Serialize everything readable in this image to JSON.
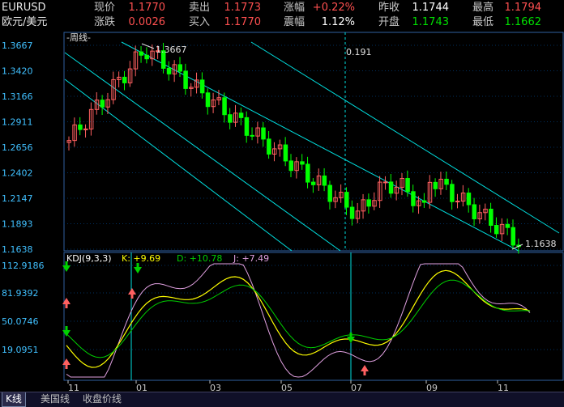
{
  "quote": {
    "symbol": "EURUSD",
    "name": "欧元/美元",
    "row1": [
      {
        "label": "现价",
        "value": "1.1770",
        "color": "red"
      },
      {
        "label": "卖出",
        "value": "1.1773",
        "color": "red"
      },
      {
        "label": "涨幅",
        "value": "+0.22%",
        "color": "red"
      },
      {
        "label": "昨收",
        "value": "1.1744",
        "color": "wht"
      },
      {
        "label": "最高",
        "value": "1.1794",
        "color": "red"
      }
    ],
    "row2": [
      {
        "label": "涨跌",
        "value": "0.0026",
        "color": "red"
      },
      {
        "label": "买入",
        "value": "1.1770",
        "color": "red"
      },
      {
        "label": "震幅",
        "value": "1.12%",
        "color": "wht"
      },
      {
        "label": "开盘",
        "value": "1.1743",
        "color": "grn"
      },
      {
        "label": "最低",
        "value": "1.1662",
        "color": "grn"
      }
    ]
  },
  "main_chart": {
    "period_label": "-周线-",
    "y_ticks": [
      "1.3667",
      "1.3420",
      "1.3166",
      "1.2911",
      "1.2656",
      "1.2402",
      "1.2147",
      "1.1893",
      "1.1638"
    ],
    "high_annotation": "1.3667",
    "low_annotation": "1.1638",
    "cursor_value": "0.191",
    "colors": {
      "up": "#ff6060",
      "down": "#00ff00",
      "channel": "#00e0e0",
      "grid": "#003060",
      "border": "#3060a0"
    }
  },
  "kdj": {
    "title": "KDJ(9,3,3)",
    "k_label": "K: +9.69",
    "d_label": "D: +10.78",
    "j_label": "J: +7.49",
    "y_ticks": [
      "112.9186",
      "81.9392",
      "50.0746",
      "19.0951"
    ],
    "colors": {
      "k": "#ffff00",
      "d": "#00d000",
      "j": "#e0a0e0"
    }
  },
  "x_ticks": [
    "11",
    "01",
    "03",
    "05",
    "07",
    "09",
    "11"
  ],
  "tabs": [
    {
      "label": "K线",
      "active": true
    },
    {
      "label": "美国线",
      "active": false
    },
    {
      "label": "收盘价线",
      "active": false
    }
  ]
}
